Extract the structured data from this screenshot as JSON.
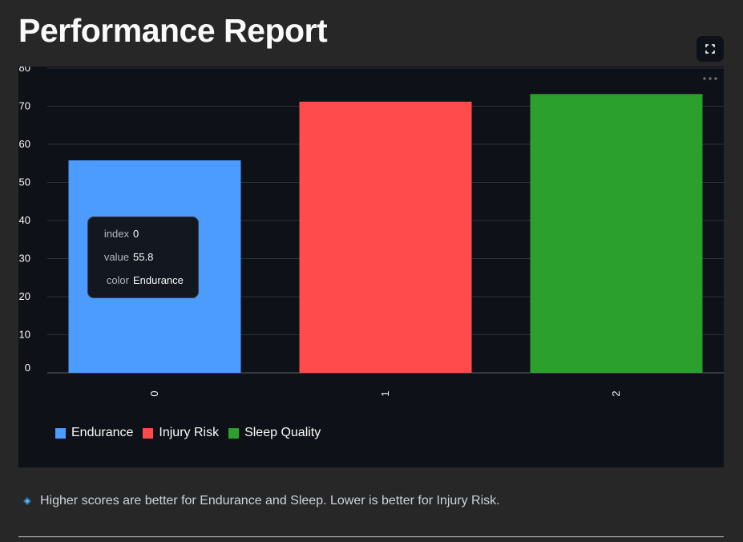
{
  "page": {
    "title": "Performance Report",
    "note": "Higher scores are better for Endurance and Sleep. Lower is better for Injury Risk."
  },
  "icons": {
    "fullscreen": "fullscreen-icon",
    "more": "more-horizontal-icon",
    "note": "diamond-bullet-icon"
  },
  "colors": {
    "background": "#272727",
    "panel": "#0e1117",
    "endurance": "#4c9bff",
    "injury_risk": "#ff4b4b",
    "sleep_quality": "#2ca02c",
    "note_bullet": "#1f77b4"
  },
  "tooltip": {
    "rows": [
      {
        "key": "index",
        "value": "0"
      },
      {
        "key": "value",
        "value": "55.8"
      },
      {
        "key": "color",
        "value": "Endurance"
      }
    ]
  },
  "chart_data": {
    "type": "bar",
    "categories": [
      "0",
      "1",
      "2"
    ],
    "series": [
      {
        "name": "Endurance",
        "category": "0",
        "value": 55.8,
        "color": "#4c9bff"
      },
      {
        "name": "Injury Risk",
        "category": "1",
        "value": 71.2,
        "color": "#ff4b4b"
      },
      {
        "name": "Sleep Quality",
        "category": "2",
        "value": 73.2,
        "color": "#2ca02c"
      }
    ],
    "ylim": [
      0,
      80
    ],
    "yticks": [
      0,
      10,
      20,
      30,
      40,
      50,
      60,
      70,
      80
    ],
    "grid": true,
    "legend_position": "bottom-left"
  }
}
